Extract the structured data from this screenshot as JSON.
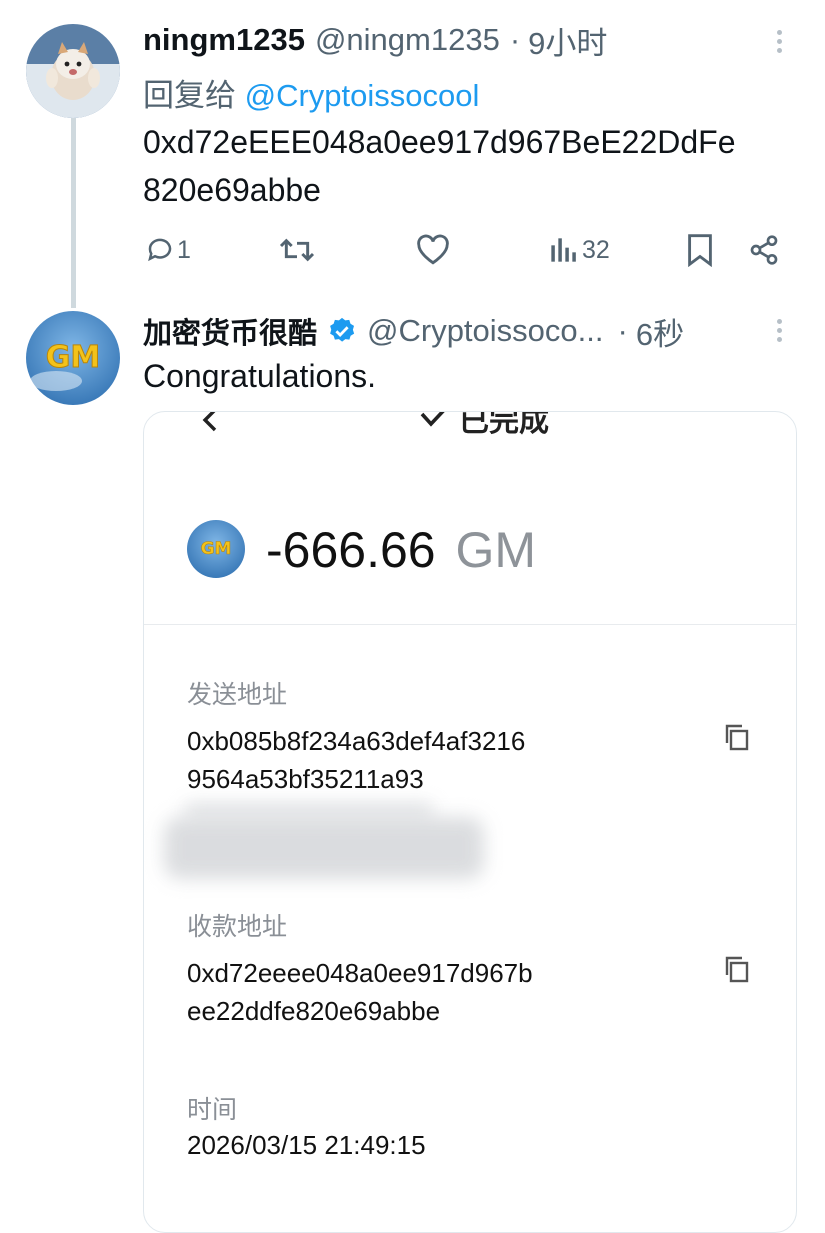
{
  "tweet1": {
    "display_name": "ningm1235",
    "handle": "@ningm1235",
    "separator": "·",
    "time": "9小时",
    "reply_prefix": "回复给",
    "reply_to": "@Cryptoissocool",
    "text_line1": "0xd72eEEE048a0ee917d967BeE22DdFe",
    "text_line2": "820e69abbe",
    "actions": {
      "reply_count": "1",
      "views_count": "32"
    },
    "avatar_icon": "cat-avatar"
  },
  "tweet2": {
    "display_name": "加密货币很酷",
    "verified_icon": "verified-badge-icon",
    "handle": "@Cryptoissoco...",
    "separator": "·",
    "time": "6秒",
    "text": "Congratulations.",
    "avatar_text": "GM"
  },
  "card": {
    "header_title": "已完成",
    "token_icon_text": "GM",
    "amount": "-666.66",
    "token": "GM",
    "send_label": "发送地址",
    "send_addr_line1": "0xb085b8f234a63def4af3216",
    "send_addr_line2": "9564a53bf35211a93",
    "recv_label": "收款地址",
    "recv_addr_line1": "0xd72eeee048a0ee917d967b",
    "recv_addr_line2": "ee22ddfe820e69abbe",
    "time_label": "时间",
    "time_value": "2026/03/15 21:49:15"
  },
  "colors": {
    "link": "#1d9bf0",
    "muted": "#536471",
    "verified": "#1d9bf0"
  }
}
